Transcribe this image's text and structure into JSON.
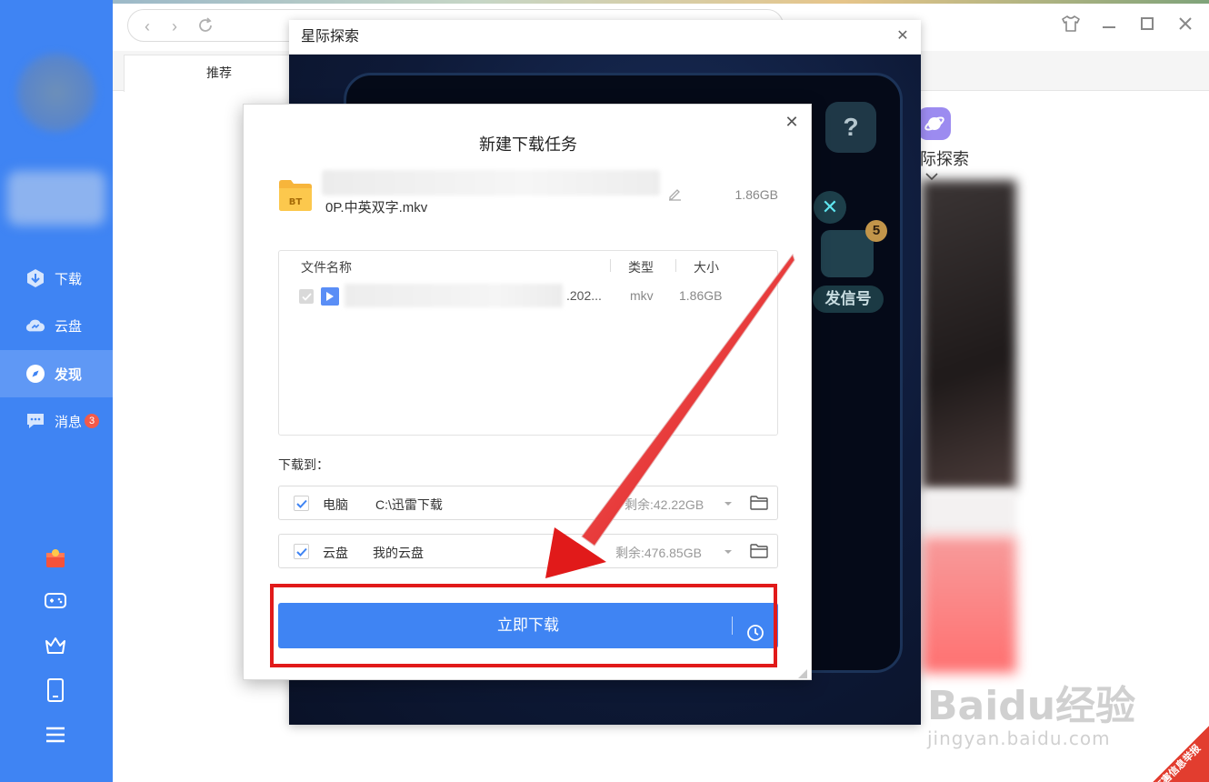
{
  "sidebar": {
    "nav": [
      {
        "label": "下载",
        "icon": "download-icon"
      },
      {
        "label": "云盘",
        "icon": "cloud-icon"
      },
      {
        "label": "发现",
        "icon": "compass-icon",
        "active": true
      },
      {
        "label": "消息",
        "icon": "message-icon",
        "badge": "3"
      }
    ],
    "tools": [
      "gift-icon",
      "gamepad-icon",
      "crown-icon",
      "tablet-icon",
      "menu-icon"
    ]
  },
  "browser": {
    "tab_label": "推荐",
    "explore_label": "际探索"
  },
  "game_window": {
    "title": "星际探索",
    "help_glyph": "?",
    "close_glyph": "✕",
    "signal_badge": "5",
    "signal_label": "发信号"
  },
  "dialog": {
    "title": "新建下载任务",
    "file_name": "0P.中英双字.mkv",
    "file_size": "1.86GB",
    "table": {
      "headers": {
        "name": "文件名称",
        "type": "类型",
        "size": "大小"
      },
      "rows": [
        {
          "name": ".202...",
          "type": "mkv",
          "size": "1.86GB"
        }
      ]
    },
    "download_to_label": "下载到：",
    "targets": [
      {
        "label": "电脑",
        "path": "C:\\迅雷下载",
        "free": "剩余:42.22GB"
      },
      {
        "label": "云盘",
        "path": "我的云盘",
        "free": "剩余:476.85GB"
      }
    ],
    "download_button": "立即下载"
  },
  "watermark": {
    "text": "Baidu经验",
    "sub": "jingyan.baidu.com"
  },
  "report_text": "有害信息举报",
  "colors": {
    "accent": "#3f84f3",
    "highlight": "#e11a1a",
    "badge": "#f25a4a"
  }
}
